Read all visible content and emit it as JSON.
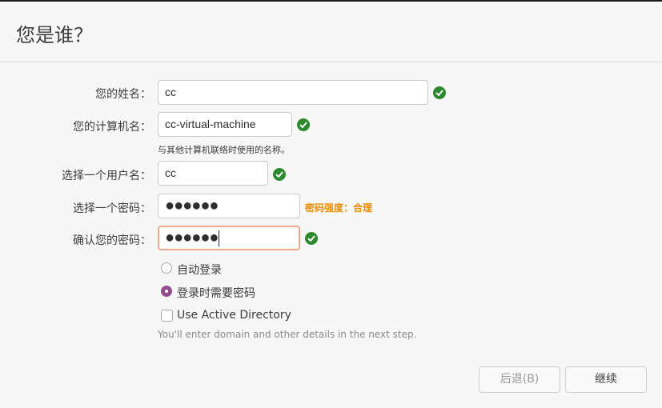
{
  "page": {
    "title": "您是谁？"
  },
  "form": {
    "name": {
      "label": "您的姓名：",
      "value": "cc",
      "valid": true
    },
    "computer": {
      "label": "您的计算机名：",
      "value": "cc-virtual-machine",
      "valid": true,
      "hint": "与其他计算机联络时使用的名称。"
    },
    "username": {
      "label": "选择一个用户名：",
      "value": "cc",
      "valid": true
    },
    "password": {
      "label": "选择一个密码：",
      "value": "●●●●●●",
      "strength": "密码强度：合理"
    },
    "confirm": {
      "label": "确认您的密码：",
      "value": "●●●●●●",
      "valid": true,
      "focused": true
    }
  },
  "login_options": {
    "auto_login": {
      "label": "自动登录",
      "selected": false
    },
    "require_password": {
      "label": "登录时需要密码",
      "selected": true
    }
  },
  "active_directory": {
    "label": "Use Active Directory",
    "checked": false,
    "note": "You'll enter domain and other details in the next step."
  },
  "buttons": {
    "back": "后退(B)",
    "continue": "继续"
  },
  "colors": {
    "valid": "#2b8a2b",
    "strength": "#f08c00",
    "accent": "#924d8b",
    "focus_border": "#f0a88d"
  }
}
